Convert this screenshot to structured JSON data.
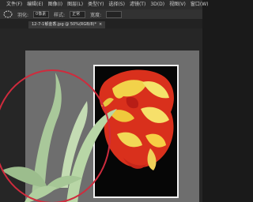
{
  "menubar": {
    "items": [
      "文件(F)",
      "编辑(E)",
      "图像(I)",
      "图层(L)",
      "类型(Y)",
      "选择(S)",
      "滤镜(T)",
      "3D(D)",
      "视图(V)",
      "窗口(W)"
    ]
  },
  "options": {
    "feather_label": "羽化:",
    "feather_value": "0像素",
    "style_label": "样式:",
    "style_value": "正常",
    "width_label": "宽度:"
  },
  "document_tab": {
    "title": "12-7-1郁金香.jpg @ 50%(RGB/8)*",
    "close": "×"
  },
  "colors": {
    "accent": "#31a8ff",
    "selection": "#cf2b3d",
    "canvas_gray": "#6e6e6e"
  }
}
